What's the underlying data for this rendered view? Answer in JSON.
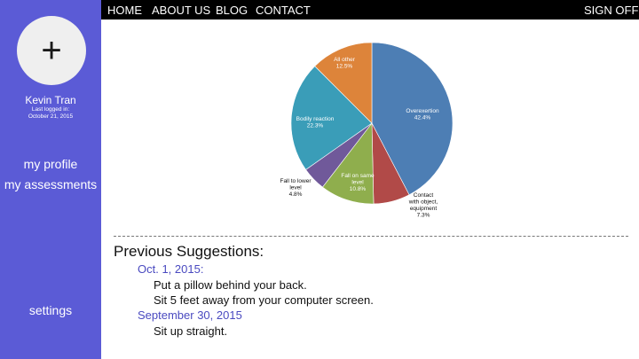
{
  "sidebar": {
    "avatar_symbol": "+",
    "user_name": "Kevin Tran",
    "last_logged_label": "Last logged in:",
    "last_logged_date": "October 21, 2015",
    "links": {
      "profile": "my profile",
      "assessments": "my assessments",
      "settings": "settings"
    }
  },
  "nav": {
    "home": "HOME",
    "about": "ABOUT US",
    "blog": "BLOG",
    "contact": "CONTACT",
    "sign_off": "SIGN OFF"
  },
  "chart_data": {
    "type": "pie",
    "slices": [
      {
        "label": [
          "Overexertion"
        ],
        "pct": "42.4%",
        "value": 42.4,
        "color": "#4d7eb4"
      },
      {
        "label": [
          "Contact",
          "with object,",
          "equipment"
        ],
        "pct": "7.3%",
        "value": 7.3,
        "color": "#b14a48"
      },
      {
        "label": [
          "Fall on same",
          "level"
        ],
        "pct": "10.8%",
        "value": 10.8,
        "color": "#8fae4d"
      },
      {
        "label": [
          "Fall to lower",
          "level"
        ],
        "pct": "4.8%",
        "value": 4.8,
        "color": "#70599a"
      },
      {
        "label": [
          "Bodily reaction"
        ],
        "pct": "22.3%",
        "value": 22.3,
        "color": "#3a9db8"
      },
      {
        "label": [
          "All other"
        ],
        "pct": "12.5%",
        "value": 12.5,
        "color": "#dd843a"
      }
    ]
  },
  "suggestions": {
    "title": "Previous Suggestions:",
    "groups": [
      {
        "date": "Oct. 1, 2015:",
        "items": [
          "Put a pillow behind your back.",
          "Sit 5 feet away from your computer screen."
        ]
      },
      {
        "date": "September 30, 2015",
        "items": [
          "Sit up straight."
        ]
      }
    ]
  }
}
